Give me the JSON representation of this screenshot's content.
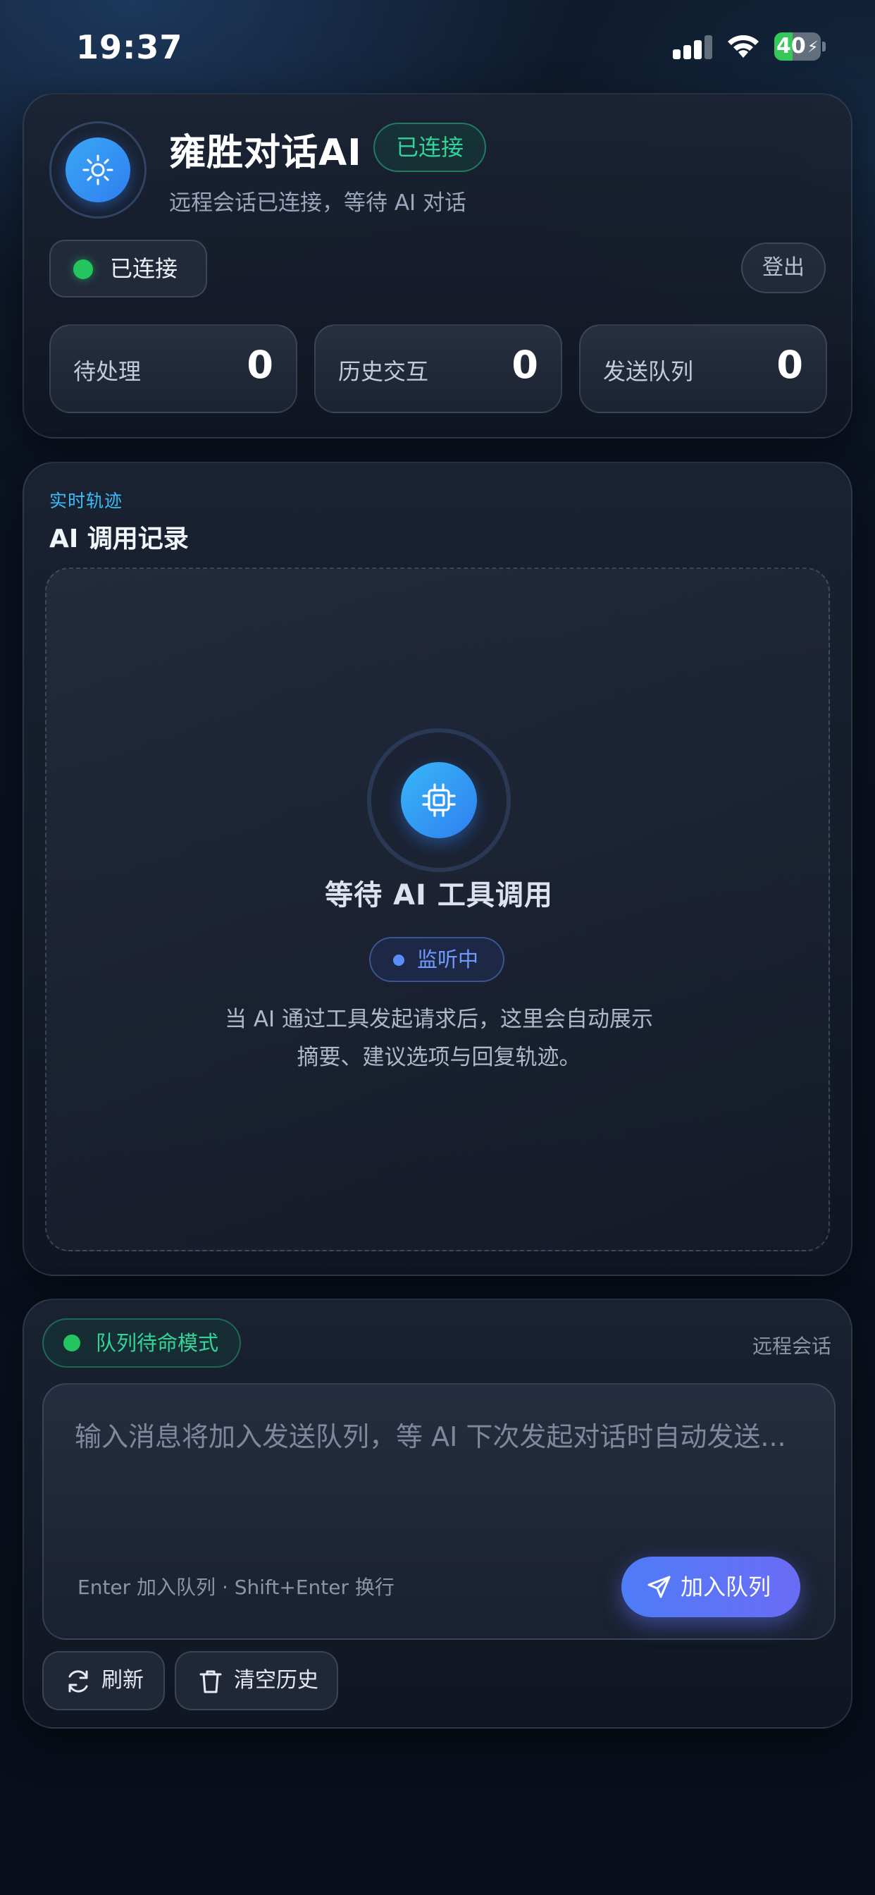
{
  "status_bar": {
    "time": "19:37",
    "battery_level": "40",
    "battery_charging": true,
    "colors": {
      "battery": "#34c759"
    }
  },
  "header": {
    "app_title": "雍胜对话AI",
    "connection_badge": "已连接",
    "subtitle": "远程会话已连接，等待 AI 对话",
    "status_pill_label": "已连接",
    "logout_label": "登出",
    "icons": {
      "logo": "sun-icon"
    },
    "stats": [
      {
        "label": "待处理",
        "value": "0"
      },
      {
        "label": "历史交互",
        "value": "0"
      },
      {
        "label": "发送队列",
        "value": "0"
      }
    ],
    "colors": {
      "connected": "#34d399",
      "accent": "#2f7ff0"
    }
  },
  "records": {
    "eyebrow": "实时轨迹",
    "title": "AI 调用记录",
    "empty_title": "等待 AI 工具调用",
    "listening_label": "监听中",
    "empty_desc_line1": "当 AI 通过工具发起请求后，这里会自动展示",
    "empty_desc_line2": "摘要、建议选项与回复轨迹。",
    "icons": {
      "empty": "cpu-chip-icon"
    },
    "colors": {
      "listening": "#6f9bff",
      "eyebrow": "#38bdf8"
    }
  },
  "composer": {
    "mode_label": "队列待命模式",
    "remote_label": "远程会话",
    "placeholder": "输入消息将加入发送队列，等 AI 下次发起对话时自动发送...",
    "hint": "Enter 加入队列 · Shift+Enter 换行",
    "enqueue_label": "加入队列",
    "refresh_label": "刷新",
    "clear_label": "清空历史",
    "icons": {
      "enqueue": "send-icon",
      "refresh": "refresh-icon",
      "clear": "trash-icon"
    },
    "colors": {
      "button_start": "#4f7cf6",
      "button_end": "#6a6cf5"
    }
  }
}
